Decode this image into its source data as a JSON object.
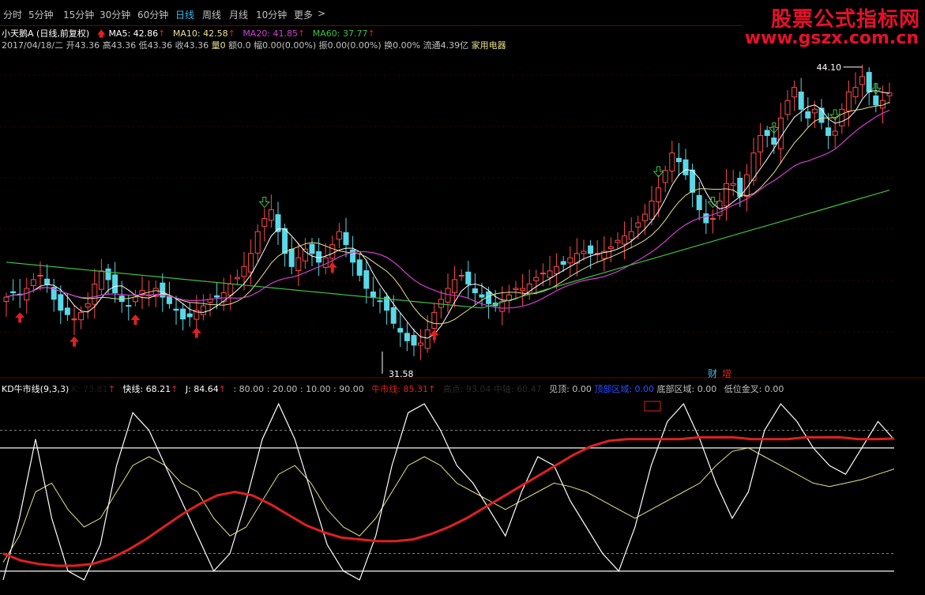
{
  "toolbar": {
    "items": [
      "分时",
      "5分钟",
      "15分钟",
      "30分钟",
      "60分钟",
      "日线",
      "周线",
      "月线",
      "10分钟",
      "更多"
    ],
    "active_index": 5,
    "more_arrow": ">"
  },
  "watermark": {
    "title": "股票公式指标网",
    "url": "www.gszx.com.cn",
    "color": "#e8102a"
  },
  "stock_line": {
    "name": "小天鹅A",
    "mode": "(日线,前复权)",
    "ma5": "MA5: 42.86",
    "ma10": "MA10: 42.58",
    "ma20": "MA20: 41.85",
    "ma60": "MA60: 37.77",
    "colors": {
      "ma5": "#ffffff",
      "ma10": "#e8e08a",
      "ma20": "#d040d0",
      "ma60": "#40c040"
    }
  },
  "quote_line": {
    "date": "2017/04/18/二",
    "open": "开43.36",
    "high": "高43.36",
    "low": "低43.36",
    "close": "收43.36",
    "vol": "量0",
    "amount": "额0.0",
    "change": "幅0.00(0.00%)",
    "amplitude": "振0.00(0.00%)",
    "turnover": "换0.00%",
    "float": "流通4.39亿",
    "industry": "家用电器"
  },
  "price_panel": {
    "high_label": "44.10",
    "low_label": "31.58",
    "badges": [
      "财",
      "增"
    ]
  },
  "indicator_line": {
    "name": "KD牛市线(9,3,3)",
    "k_hidden": "K: 73.81",
    "fast": "快线: 68.21",
    "j": "J: 84.64",
    "c80": ": 80.00",
    "c20": ": 20.00",
    "c10": ": 10.00",
    "c90": ": 90.00",
    "bull": "牛市线: 85.31",
    "hidden1": "高点: 93.04",
    "hidden2": "中轴: 60.47",
    "top": "见顶: 0.00",
    "top_zone": "顶部区域: 0.00",
    "bottom_zone": "底部区域: 0.00",
    "golden": "低位金叉: 0.00"
  },
  "chart_data": [
    {
      "type": "candlestick",
      "title": "小天鹅A 日线",
      "series": [
        {
          "name": "price_close",
          "values": [
            34.0,
            34.2,
            34.1,
            34.4,
            34.8,
            35.0,
            34.6,
            33.9,
            33.4,
            33.2,
            33.0,
            33.3,
            33.7,
            34.6,
            35.2,
            34.8,
            34.2,
            33.8,
            33.6,
            34.0,
            34.3,
            34.1,
            34.4,
            34.0,
            33.7,
            33.4,
            33.0,
            33.1,
            33.4,
            33.6,
            33.9,
            34.0,
            34.2,
            34.6,
            34.9,
            35.4,
            36.0,
            37.0,
            37.6,
            38.0,
            37.0,
            36.0,
            35.4,
            35.8,
            36.2,
            36.0,
            35.6,
            35.8,
            36.4,
            37.0,
            36.4,
            35.6,
            35.0,
            34.4,
            34.0,
            33.8,
            33.4,
            32.8,
            32.4,
            32.0,
            31.8,
            31.9,
            32.5,
            33.3,
            33.9,
            34.4,
            34.8,
            35.0,
            34.6,
            34.2,
            34.0,
            33.7,
            33.6,
            33.8,
            34.1,
            34.4,
            34.4,
            34.6,
            34.9,
            35.1,
            35.2,
            35.4,
            35.5,
            35.8,
            36.0,
            36.1,
            36.0,
            36.0,
            36.1,
            36.3,
            36.6,
            36.8,
            37.0,
            37.4,
            37.8,
            38.4,
            39.0,
            39.8,
            40.6,
            40.2,
            39.6,
            38.8,
            38.0,
            37.4,
            37.6,
            38.4,
            39.2,
            39.2,
            38.6,
            39.6,
            40.6,
            41.4,
            41.4,
            41.0,
            42.2,
            43.0,
            43.6,
            42.6,
            42.2,
            42.6,
            42.0,
            41.4,
            41.6,
            42.6,
            43.4,
            43.6,
            44.1,
            43.4,
            42.8,
            43.0,
            43.36
          ]
        },
        {
          "name": "MA5",
          "values": [
            42.86
          ]
        },
        {
          "name": "MA10",
          "values": [
            42.58
          ]
        },
        {
          "name": "MA20",
          "values": [
            41.85
          ]
        },
        {
          "name": "MA60",
          "values": [
            37.77
          ]
        }
      ],
      "annotations": [
        {
          "text": "44.10",
          "kind": "high"
        },
        {
          "text": "31.58",
          "kind": "low"
        }
      ]
    },
    {
      "type": "line",
      "title": "KD牛市线(9,3,3)",
      "reference_lines": [
        80,
        20,
        10,
        90
      ],
      "series": [
        {
          "name": "快线",
          "values": [
            15,
            30,
            55,
            60,
            45,
            35,
            40,
            55,
            70,
            75,
            70,
            60,
            55,
            40,
            30,
            35,
            50,
            65,
            70,
            60,
            45,
            35,
            30,
            40,
            55,
            70,
            75,
            70,
            60,
            55,
            50,
            45,
            50,
            55,
            60,
            58,
            55,
            50,
            45,
            40,
            45,
            50,
            55,
            60,
            70,
            78,
            80,
            75,
            70,
            65,
            60,
            58,
            60,
            62,
            65,
            68
          ]
        },
        {
          "name": "J",
          "values": [
            5,
            40,
            85,
            40,
            10,
            5,
            25,
            70,
            100,
            90,
            70,
            50,
            30,
            10,
            20,
            50,
            85,
            105,
            85,
            55,
            25,
            10,
            5,
            30,
            70,
            100,
            105,
            90,
            70,
            60,
            45,
            30,
            55,
            75,
            70,
            50,
            35,
            20,
            10,
            35,
            70,
            95,
            105,
            85,
            60,
            40,
            55,
            90,
            105,
            95,
            80,
            70,
            65,
            80,
            95,
            84.64
          ]
        },
        {
          "name": "牛市线",
          "values": [
            20,
            16,
            14,
            13,
            13,
            14,
            17,
            22,
            28,
            35,
            42,
            48,
            53,
            55,
            53,
            48,
            42,
            36,
            32,
            29,
            28,
            27,
            27,
            28,
            31,
            35,
            40,
            46,
            52,
            58,
            64,
            70,
            76,
            81,
            84,
            85,
            85,
            85,
            85,
            86,
            86,
            86,
            85,
            85,
            85,
            86,
            86,
            86,
            85,
            85,
            85.31
          ]
        }
      ]
    }
  ]
}
